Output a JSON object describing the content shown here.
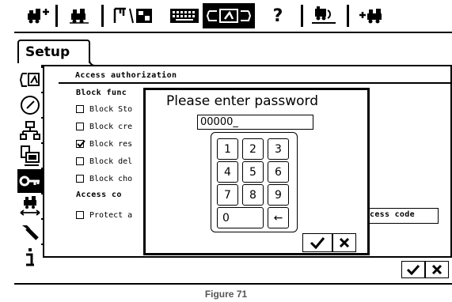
{
  "tab": {
    "label": "Setup"
  },
  "section": {
    "title": "Access authorization"
  },
  "block_functions": {
    "heading": "Block func",
    "items": [
      {
        "label": "Block Sto",
        "checked": false
      },
      {
        "label": "Block cre",
        "checked": false
      },
      {
        "label": "Block res",
        "checked": true
      },
      {
        "label": "Block del",
        "checked": false
      },
      {
        "label": "Block cho",
        "checked": false
      }
    ]
  },
  "access_code": {
    "heading": "Access co",
    "protect_label": "Protect a",
    "protect_checked": false,
    "field_label": "cess code"
  },
  "dialog": {
    "title": "Please enter password",
    "password_value": "00000_",
    "keys": [
      "1",
      "2",
      "3",
      "4",
      "5",
      "6",
      "7",
      "8",
      "9",
      "0",
      "←"
    ]
  },
  "toolbar": {
    "icons": [
      "locomotive-add-icon",
      "locomotive-icon",
      "signal-panel-icon",
      "keyboard-icon",
      "control-panel-icon",
      "help-icon",
      "turntable-icon",
      "locomotive-right-icon"
    ],
    "help_label": "?"
  },
  "sidebar": {
    "icons": [
      "settings-icon",
      "clock-icon",
      "network-icon",
      "computer-icon",
      "key-icon",
      "locomotive-arrows-icon",
      "wrench-icon",
      "info-icon"
    ],
    "selected_index": 4
  },
  "caption": "Figure 71"
}
